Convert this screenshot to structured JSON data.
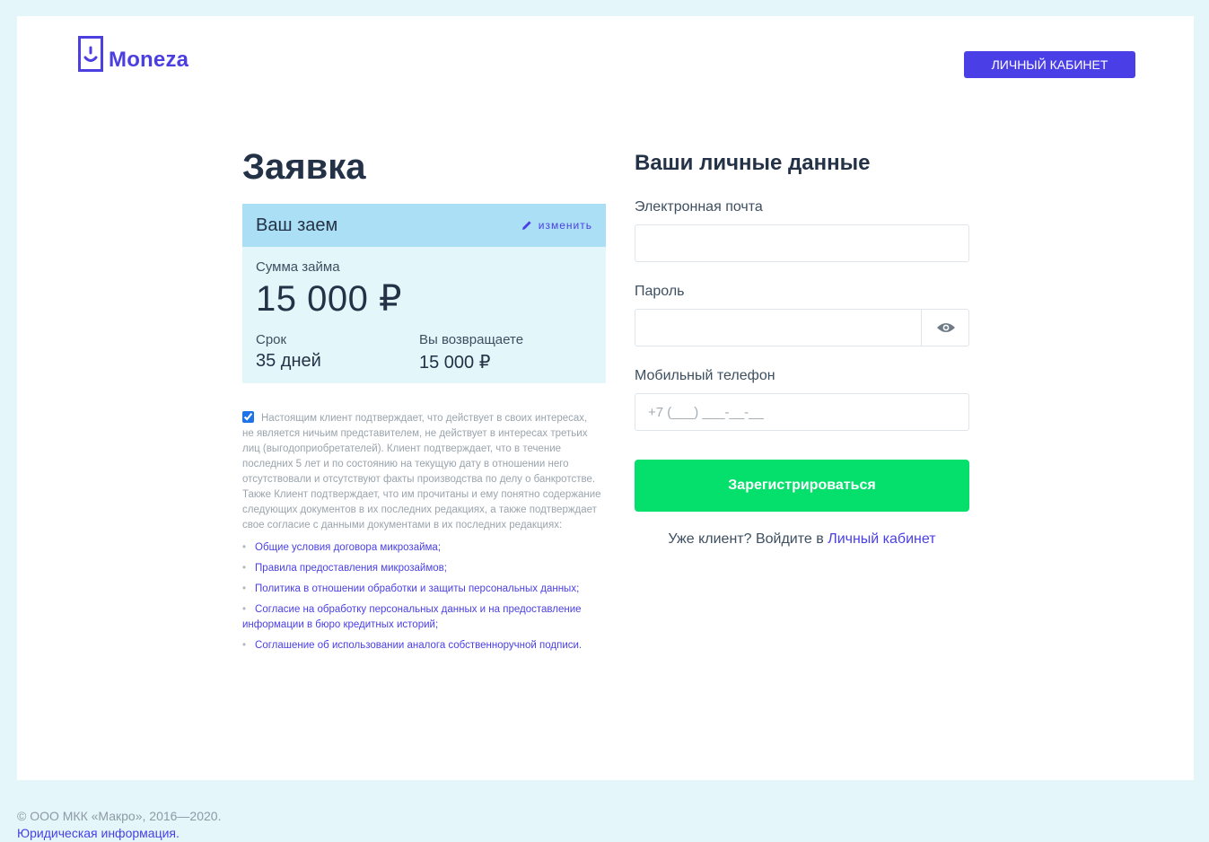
{
  "header": {
    "logo_text": "Moneza",
    "cabinet_button": "Личный кабинет"
  },
  "application": {
    "title": "Заявка",
    "loan_card": {
      "heading": "Ваш заем",
      "edit_label": "изменить",
      "amount_label": "Сумма займа",
      "amount_value": "15 000 ₽",
      "term_label": "Срок",
      "term_value": "35 дней",
      "return_label": "Вы возвращаете",
      "return_value": "15 000 ₽"
    },
    "consent": {
      "checked": true,
      "text": "Настоящим клиент подтверждает, что действует в своих интересах, не является ничьим представителем, не действует в интересах третьих лиц (выгодоприобретателей). Клиент подтверждает, что в течение последних 5 лет и по состоянию на текущую дату в отношении него отсутствовали и отсутствуют факты производства по делу о банкротстве. Также Клиент подтверждает, что им прочитаны и ему понятно содержание следующих документов в их последних редакциях, а также подтверждает свое согласие с данными документами в их последних редакциях:",
      "documents": [
        "Общие условия договора микрозайма;",
        "Правила предоставления микрозаймов;",
        "Политика в отношении обработки и защиты персональных данных;",
        "Согласие на обработку персональных данных и на предоставление информации в бюро кредитных историй;",
        "Соглашение об использовании аналога собственноручной подписи."
      ]
    }
  },
  "form": {
    "title": "Ваши личные данные",
    "email_label": "Электронная почта",
    "email_value": "",
    "password_label": "Пароль",
    "password_value": "",
    "phone_label": "Мобильный телефон",
    "phone_placeholder": "+7 (___) ___-__-__",
    "register_button": "Зарегистрироваться",
    "login_hint_prefix": "Уже клиент? Войдите в",
    "login_hint_link": "Личный кабинет"
  },
  "footer": {
    "copyright": "© ООО МКК «Макро», 2016—2020.",
    "legal_link": "Юридическая информация."
  },
  "colors": {
    "accent": "#4a3fe6",
    "register_green": "#05e06c",
    "loan_header": "#abdff5",
    "loan_body": "#e3f6fa",
    "page_bg": "#e4f6f9"
  },
  "icons": {
    "logo": "phone-smile-icon",
    "edit": "pencil-icon",
    "password_toggle": "eye-icon"
  }
}
